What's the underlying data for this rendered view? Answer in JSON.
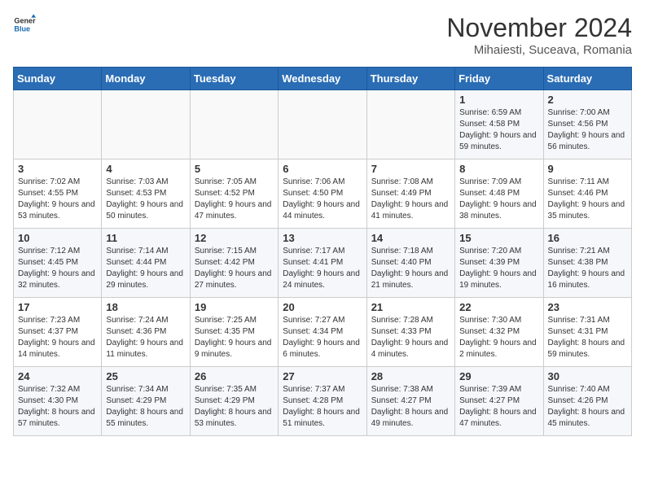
{
  "header": {
    "logo_general": "General",
    "logo_blue": "Blue",
    "month_title": "November 2024",
    "location": "Mihaiesti, Suceava, Romania"
  },
  "days_of_week": [
    "Sunday",
    "Monday",
    "Tuesday",
    "Wednesday",
    "Thursday",
    "Friday",
    "Saturday"
  ],
  "weeks": [
    [
      {
        "day": "",
        "info": ""
      },
      {
        "day": "",
        "info": ""
      },
      {
        "day": "",
        "info": ""
      },
      {
        "day": "",
        "info": ""
      },
      {
        "day": "",
        "info": ""
      },
      {
        "day": "1",
        "info": "Sunrise: 6:59 AM\nSunset: 4:58 PM\nDaylight: 9 hours and 59 minutes."
      },
      {
        "day": "2",
        "info": "Sunrise: 7:00 AM\nSunset: 4:56 PM\nDaylight: 9 hours and 56 minutes."
      }
    ],
    [
      {
        "day": "3",
        "info": "Sunrise: 7:02 AM\nSunset: 4:55 PM\nDaylight: 9 hours and 53 minutes."
      },
      {
        "day": "4",
        "info": "Sunrise: 7:03 AM\nSunset: 4:53 PM\nDaylight: 9 hours and 50 minutes."
      },
      {
        "day": "5",
        "info": "Sunrise: 7:05 AM\nSunset: 4:52 PM\nDaylight: 9 hours and 47 minutes."
      },
      {
        "day": "6",
        "info": "Sunrise: 7:06 AM\nSunset: 4:50 PM\nDaylight: 9 hours and 44 minutes."
      },
      {
        "day": "7",
        "info": "Sunrise: 7:08 AM\nSunset: 4:49 PM\nDaylight: 9 hours and 41 minutes."
      },
      {
        "day": "8",
        "info": "Sunrise: 7:09 AM\nSunset: 4:48 PM\nDaylight: 9 hours and 38 minutes."
      },
      {
        "day": "9",
        "info": "Sunrise: 7:11 AM\nSunset: 4:46 PM\nDaylight: 9 hours and 35 minutes."
      }
    ],
    [
      {
        "day": "10",
        "info": "Sunrise: 7:12 AM\nSunset: 4:45 PM\nDaylight: 9 hours and 32 minutes."
      },
      {
        "day": "11",
        "info": "Sunrise: 7:14 AM\nSunset: 4:44 PM\nDaylight: 9 hours and 29 minutes."
      },
      {
        "day": "12",
        "info": "Sunrise: 7:15 AM\nSunset: 4:42 PM\nDaylight: 9 hours and 27 minutes."
      },
      {
        "day": "13",
        "info": "Sunrise: 7:17 AM\nSunset: 4:41 PM\nDaylight: 9 hours and 24 minutes."
      },
      {
        "day": "14",
        "info": "Sunrise: 7:18 AM\nSunset: 4:40 PM\nDaylight: 9 hours and 21 minutes."
      },
      {
        "day": "15",
        "info": "Sunrise: 7:20 AM\nSunset: 4:39 PM\nDaylight: 9 hours and 19 minutes."
      },
      {
        "day": "16",
        "info": "Sunrise: 7:21 AM\nSunset: 4:38 PM\nDaylight: 9 hours and 16 minutes."
      }
    ],
    [
      {
        "day": "17",
        "info": "Sunrise: 7:23 AM\nSunset: 4:37 PM\nDaylight: 9 hours and 14 minutes."
      },
      {
        "day": "18",
        "info": "Sunrise: 7:24 AM\nSunset: 4:36 PM\nDaylight: 9 hours and 11 minutes."
      },
      {
        "day": "19",
        "info": "Sunrise: 7:25 AM\nSunset: 4:35 PM\nDaylight: 9 hours and 9 minutes."
      },
      {
        "day": "20",
        "info": "Sunrise: 7:27 AM\nSunset: 4:34 PM\nDaylight: 9 hours and 6 minutes."
      },
      {
        "day": "21",
        "info": "Sunrise: 7:28 AM\nSunset: 4:33 PM\nDaylight: 9 hours and 4 minutes."
      },
      {
        "day": "22",
        "info": "Sunrise: 7:30 AM\nSunset: 4:32 PM\nDaylight: 9 hours and 2 minutes."
      },
      {
        "day": "23",
        "info": "Sunrise: 7:31 AM\nSunset: 4:31 PM\nDaylight: 8 hours and 59 minutes."
      }
    ],
    [
      {
        "day": "24",
        "info": "Sunrise: 7:32 AM\nSunset: 4:30 PM\nDaylight: 8 hours and 57 minutes."
      },
      {
        "day": "25",
        "info": "Sunrise: 7:34 AM\nSunset: 4:29 PM\nDaylight: 8 hours and 55 minutes."
      },
      {
        "day": "26",
        "info": "Sunrise: 7:35 AM\nSunset: 4:29 PM\nDaylight: 8 hours and 53 minutes."
      },
      {
        "day": "27",
        "info": "Sunrise: 7:37 AM\nSunset: 4:28 PM\nDaylight: 8 hours and 51 minutes."
      },
      {
        "day": "28",
        "info": "Sunrise: 7:38 AM\nSunset: 4:27 PM\nDaylight: 8 hours and 49 minutes."
      },
      {
        "day": "29",
        "info": "Sunrise: 7:39 AM\nSunset: 4:27 PM\nDaylight: 8 hours and 47 minutes."
      },
      {
        "day": "30",
        "info": "Sunrise: 7:40 AM\nSunset: 4:26 PM\nDaylight: 8 hours and 45 minutes."
      }
    ]
  ]
}
